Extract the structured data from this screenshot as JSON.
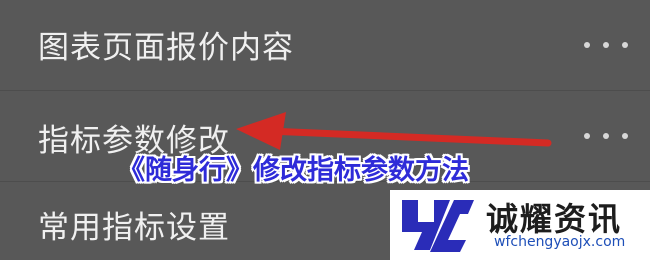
{
  "menu": {
    "items": [
      {
        "label": "图表页面报价内容"
      },
      {
        "label": "指标参数修改"
      },
      {
        "label": "常用指标设置"
      }
    ]
  },
  "overlay": {
    "caption": "《随身行》修改指标参数方法",
    "caption_color": "#2e2bd8",
    "arrow_color": "#d42a24"
  },
  "watermark": {
    "name": "诚耀资讯",
    "url": "wfchengyaojx.com",
    "logo_color": "#2a2cb8"
  }
}
